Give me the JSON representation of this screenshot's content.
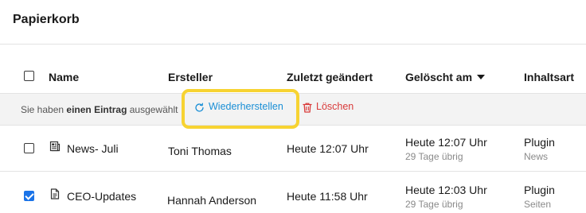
{
  "page": {
    "title": "Papierkorb"
  },
  "table": {
    "columns": [
      "Name",
      "Ersteller",
      "Zuletzt geändert",
      "Gelöscht am",
      "Inhaltsart"
    ],
    "sorted_column": "Gelöscht am",
    "sort_direction": "descending"
  },
  "selection": {
    "prefix": "Sie haben ",
    "count_text": "einen Eintrag",
    "suffix": " ausgewählt",
    "restore_label": "Wiederherstellen",
    "delete_label": "Löschen"
  },
  "rows": [
    {
      "checked": false,
      "icon": "news-icon",
      "name": "News- Juli",
      "creator": "Toni Thomas",
      "modified": "Heute 12:07 Uhr",
      "deleted": "Heute 12:07 Uhr",
      "deleted_sub": "29 Tage übrig",
      "type": "Plugin",
      "type_sub": "News"
    },
    {
      "checked": true,
      "icon": "document-icon",
      "name": "CEO-Updates",
      "creator": "Hannah Anderson",
      "modified": "Heute 11:58 Uhr",
      "deleted": "Heute 12:03 Uhr",
      "deleted_sub": "29 Tage übrig",
      "type": "Plugin",
      "type_sub": "Seiten"
    }
  ],
  "colors": {
    "highlight": "#f7d332",
    "restore": "#1a8fd6",
    "delete": "#d93a3a",
    "checkbox_checked": "#1a73e8"
  }
}
